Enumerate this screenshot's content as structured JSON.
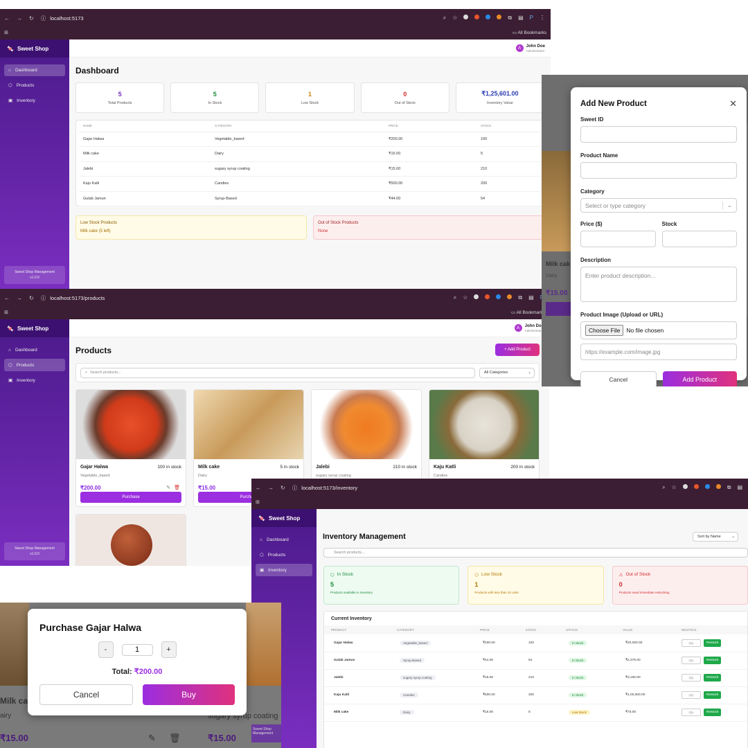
{
  "browser": {
    "dashboard_url": "localhost:5173",
    "products_url": "localhost:5173/products",
    "inventory_url": "localhost:5173/inventory",
    "bookmarks": "All Bookmarks",
    "profile": "P"
  },
  "app": {
    "brand": "Sweet Shop",
    "nav": [
      "Dashboard",
      "Products",
      "Inventory"
    ],
    "footer_title": "Sweet Shop Management",
    "footer_version": "v1.0.0",
    "user_name": "John Doe",
    "user_role": "Administrator",
    "avatar_letter": "A"
  },
  "dashboard": {
    "title": "Dashboard",
    "stats": [
      {
        "value": "5",
        "label": "Total Products",
        "color": "#7a2ec0"
      },
      {
        "value": "5",
        "label": "In Stock",
        "color": "#1a8a3a"
      },
      {
        "value": "1",
        "label": "Low Stock",
        "color": "#c7860a"
      },
      {
        "value": "0",
        "label": "Out of Stock",
        "color": "#d12a2a"
      },
      {
        "value": "₹1,25,601.00",
        "label": "Inventory Value",
        "color": "#2a3db0"
      }
    ],
    "columns": [
      "NAME",
      "CATEGORY",
      "PRICE",
      "STOCK"
    ],
    "rows": [
      [
        "Gajar Halwa",
        "Vegetable_based",
        "₹200.00",
        "100"
      ],
      [
        "Milk cake",
        "Dairy",
        "₹15.00",
        "5"
      ],
      [
        "Jalebi",
        "sugary syrup coating",
        "₹15.00",
        "210"
      ],
      [
        "Kaju Katli",
        "Candies",
        "₹500.00",
        "200"
      ],
      [
        "Gulab Jamun",
        "Syrup-Based",
        "₹44.00",
        "54"
      ]
    ],
    "low_title": "Low Stock Products",
    "low_item": "Milk cake (5 left)",
    "out_title": "Out of Stock Products",
    "out_item": "None"
  },
  "products": {
    "title": "Products",
    "add_label": "+ Add Product",
    "search_placeholder": "Search products...",
    "category_filter": "All Categories",
    "cards": [
      {
        "name": "Gajar Halwa",
        "stock": "100 in stock",
        "category": "Vegetable_based",
        "price": "₹200.00",
        "buy": "Purchase"
      },
      {
        "name": "Milk cake",
        "stock": "5 in stock",
        "category": "Dairy",
        "price": "₹15.00",
        "buy": "Purchase"
      },
      {
        "name": "Jalebi",
        "stock": "210 in stock",
        "category": "sugary syrup coating"
      },
      {
        "name": "Kaju Katli",
        "stock": "200 in stock",
        "category": "Candies"
      }
    ]
  },
  "add_modal": {
    "title": "Add New Product",
    "sweet_id": "Sweet ID",
    "product_name": "Product Name",
    "category": "Category",
    "category_placeholder": "Select or type category",
    "price": "Price ($)",
    "stock": "Stock",
    "description": "Description",
    "description_placeholder": "Enter product description...",
    "image": "Product Image (Upload or URL)",
    "choose_file": "Choose File",
    "no_file": "No file chosen",
    "url_placeholder": "https://example.com/image.jpg",
    "cancel": "Cancel",
    "submit": "Add Product",
    "behind_name": "Milk cak",
    "behind_cat": "Dairy",
    "behind_price": "₹15.00"
  },
  "inventory": {
    "title": "Inventory Management",
    "sort": "Sort by Name",
    "search_placeholder": "Search products...",
    "cards": [
      {
        "title": "In Stock",
        "value": "5",
        "desc": "Products available in inventory"
      },
      {
        "title": "Low Stock",
        "value": "1",
        "desc": "Products with less than 10 units"
      },
      {
        "title": "Out of Stock",
        "value": "0",
        "desc": "Products need immediate restocking"
      }
    ],
    "table_title": "Current Inventory",
    "columns": [
      "PRODUCT",
      "CATEGORY",
      "PRICE",
      "STOCK",
      "STATUS",
      "VALUE",
      "RESTOCK"
    ],
    "rows": [
      [
        "Gajar Halwa",
        "Vegetable_based",
        "₹200.00",
        "100",
        "In Stock",
        "₹20,000.00"
      ],
      [
        "Gulab Jamun",
        "Syrup-Based",
        "₹44.00",
        "54",
        "In Stock",
        "₹2,376.00"
      ],
      [
        "Jalebi",
        "sugary syrup coating",
        "₹15.00",
        "210",
        "In Stock",
        "₹3,150.00"
      ],
      [
        "Kaju Katli",
        "Candies",
        "₹500.00",
        "200",
        "In Stock",
        "₹1,00,000.00"
      ],
      [
        "Milk cake",
        "Dairy",
        "₹15.00",
        "5",
        "Low Stock",
        "₹75.00"
      ]
    ],
    "qty_placeholder": "Qty",
    "restock": "Restock"
  },
  "purchase_modal": {
    "title": "Purchase Gajar Halwa",
    "minus": "-",
    "qty": "1",
    "plus": "+",
    "total_label": "Total:",
    "total_value": "₹200.00",
    "cancel": "Cancel",
    "buy": "Buy",
    "behind_name": "Milk cak",
    "behind_cat": "airy",
    "behind_price": "₹15.00",
    "behind_price2": "₹15.00",
    "behind_cat2": "sugary syrup coating"
  }
}
